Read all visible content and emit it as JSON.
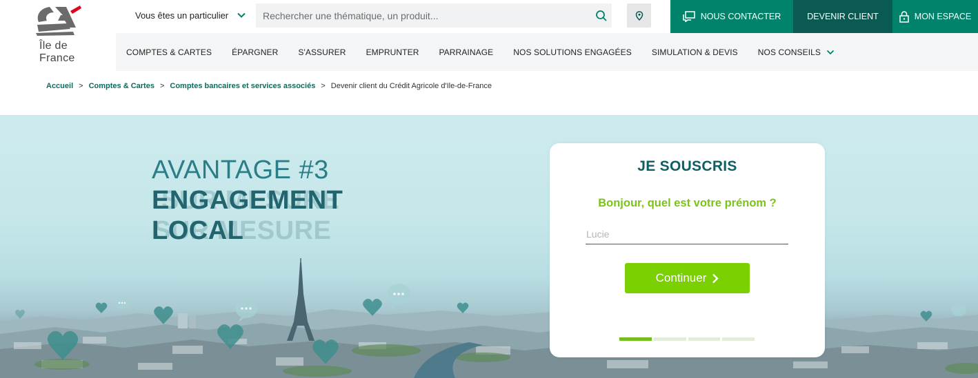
{
  "logo": {
    "line1": "Île de",
    "line2": "France"
  },
  "topbar": {
    "profile": "Vous êtes un particulier",
    "search_placeholder": "Rechercher une thématique, un produit...",
    "contact_label": "NOUS CONTACTER",
    "client_label": "DEVENIR CLIENT",
    "space_label": "MON ESPACE"
  },
  "nav": {
    "items": [
      "COMPTES & CARTES",
      "ÉPARGNER",
      "S'ASSURER",
      "EMPRUNTER",
      "PARRAINAGE",
      "NOS SOLUTIONS ENGAGÉES",
      "SIMULATION & DEVIS",
      "NOS CONSEILS"
    ]
  },
  "breadcrumb": {
    "items": [
      "Accueil",
      "Comptes & Cartes",
      "Comptes bancaires et services associés"
    ],
    "separator": ">",
    "current": "Devenir client du Crédit Agricole d'Ile-de-France"
  },
  "hero": {
    "line1": "AVANTAGE #3",
    "line2": "ENGAGEMENT",
    "line3": "LOCAL",
    "ghost2": "SUR MESURE",
    "ghost3": "SUR MESURE"
  },
  "form": {
    "title": "JE SOUSCRIS",
    "question": "Bonjour, quel est votre prénom ?",
    "input_placeholder": "Lucie",
    "button_label": "Continuer",
    "steps_total": 4,
    "step_current": 1
  },
  "colors": {
    "brand_green": "#00826b",
    "brand_dark": "#0a5a52",
    "cta_green": "#7ad000",
    "logo_red": "#e2001a"
  },
  "icons": {
    "profile_chevron": "chevron-down-icon",
    "search": "search-icon",
    "location": "location-pin-icon",
    "contact": "chat-bubble-icon",
    "space": "lock-icon",
    "continue": "chevron-right-icon"
  }
}
